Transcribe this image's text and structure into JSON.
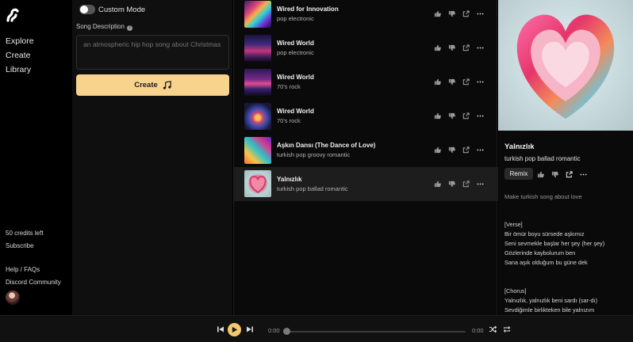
{
  "nav": {
    "links": [
      "Explore",
      "Create",
      "Library"
    ],
    "credits": "50 credits left",
    "subscribe": "Subscribe",
    "help": "Help / FAQs",
    "discord": "Discord Community"
  },
  "create": {
    "custom_mode_label": "Custom Mode",
    "description_label": "Song Description",
    "description_placeholder": "an atmospheric hip hop song about Christmas",
    "create_button": "Create"
  },
  "songs": [
    {
      "title": "Wired for Innovation",
      "tags": "pop electronic"
    },
    {
      "title": "Wired World",
      "tags": "pop electronic"
    },
    {
      "title": "Wired World",
      "tags": "70's rock"
    },
    {
      "title": "Wired World",
      "tags": "70's rock"
    },
    {
      "title": "Aşkın Dansı (The Dance of Love)",
      "tags": "turkish pop groovy romantic"
    },
    {
      "title": "Yalnızlık",
      "tags": "turkish pop ballad romantic"
    }
  ],
  "detail": {
    "title": "Yalnızlık",
    "tags": "turkish pop ballad romantic",
    "remix": "Remix",
    "prompt": "Make turkish song about love",
    "verse_lines": [
      "[Verse]",
      "Bir ömür boyu sürsede aşkımız",
      "Seni sevmekle başlar her şey (her şey)",
      "Gözlerinde kaybolurum ben",
      "Sana aşık olduğum bu güne dek"
    ],
    "chorus_lines": [
      "[Chorus]",
      "Yalnızlık, yalnızlık beni sardı (sar-dı)",
      "Sevdiğimle birlikteken bile yalnızım"
    ]
  },
  "player": {
    "current_time": "0:00",
    "total_time": "0:00"
  },
  "colors": {
    "accent": "#f7d38d",
    "play": "#f3c86f"
  }
}
